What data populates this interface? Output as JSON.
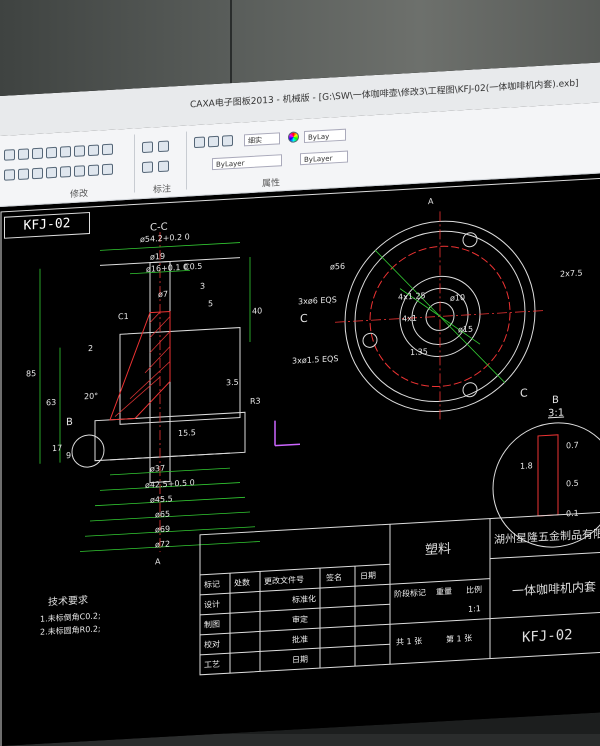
{
  "window": {
    "title": "CAXA电子图板2013 - 机械版 - [G:\\SW\\一体咖啡壶\\修改3\\工程图\\KFJ-02(一体咖啡机内套).exb]"
  },
  "ribbon": {
    "groups": [
      {
        "label": "修改"
      },
      {
        "label": "标注"
      },
      {
        "label": "属性"
      }
    ],
    "hatch_combo": "细实",
    "layer_combo_1": "ByLay",
    "linetype_combo": "ByLayer",
    "lineweight_combo": "ByLayer",
    "color_combo": "ByLay"
  },
  "drawing": {
    "tab_title": "KFJ-02",
    "section_label": "C-C",
    "detail_label": "B",
    "detail_scale": "3:1",
    "view_marker_a": "A",
    "view_marker_c": "C",
    "dims_section": [
      "ø54.2+0.2 0",
      "ø19",
      "ø16+0.1 0",
      "C0.5",
      "ø7",
      "C1",
      "3",
      "2",
      "5",
      "40",
      "85",
      "63",
      "17",
      "9",
      "ø37",
      "ø42.5+0.5 0",
      "ø45.5",
      "ø65",
      "ø69",
      "ø72",
      "R3",
      "15.5",
      "3.5",
      "20°",
      "B"
    ],
    "dims_top": [
      "ø56",
      "3xø6 EQS",
      "3xø1.5 EQS",
      "4x1.25",
      "4x1",
      "ø10",
      "ø15",
      "1.35",
      "2x7.5",
      "C",
      "C"
    ],
    "dims_detail": [
      "0.7",
      "1.8",
      "0.5",
      "0.1"
    ]
  },
  "notes": {
    "title": "技术要求",
    "lines": [
      "1.未标倒角C0.2;",
      "2.未标圆角R0.2;"
    ]
  },
  "titleblock": {
    "material": "塑料",
    "company": "湖州星隆五金制品有限公",
    "part_name": "一体咖啡机内套",
    "drawing_no": "KFJ-02",
    "header_cells": [
      "标记",
      "处数",
      "更改文件号",
      "签名",
      "日期"
    ],
    "rows": [
      "设计",
      "制图",
      "校对",
      "工艺"
    ],
    "std_cells": [
      "标准化",
      "审定",
      "批准",
      "日期"
    ],
    "stage_label": "阶段标记",
    "weight_label": "重量",
    "scale_label": "比例",
    "scale_value": "1:1",
    "sheets_total": "共 1 张",
    "sheet_no": "第 1 张"
  }
}
